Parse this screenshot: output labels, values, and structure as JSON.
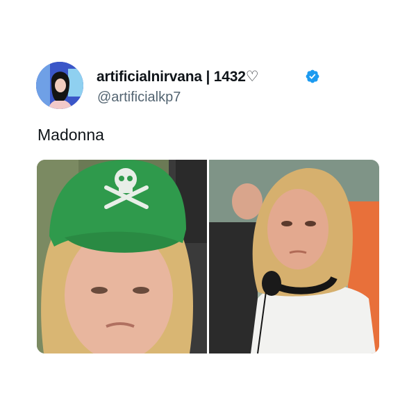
{
  "tweet": {
    "display_name": "artificialnirvana | 1432♡",
    "handle": "@artificialkp7",
    "text": "Madonna"
  },
  "icons": {
    "avatar": "profile-avatar",
    "verified": "verified-badge-icon"
  },
  "media": {
    "count": 2,
    "photos": [
      {
        "description": "woman-green-skull-cap"
      },
      {
        "description": "woman-white-tshirt-headphones"
      }
    ]
  },
  "colors": {
    "verified_badge": "#1d9bf0",
    "handle_text": "#536471",
    "cap_green": "#2f9a4c"
  }
}
